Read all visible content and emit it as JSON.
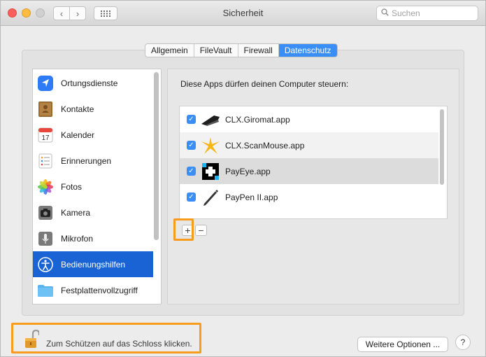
{
  "window": {
    "title": "Sicherheit"
  },
  "search": {
    "placeholder": "Suchen"
  },
  "tabs": [
    {
      "label": "Allgemein",
      "active": false
    },
    {
      "label": "FileVault",
      "active": false
    },
    {
      "label": "Firewall",
      "active": false
    },
    {
      "label": "Datenschutz",
      "active": true
    }
  ],
  "sidebar": {
    "items": [
      {
        "label": "Ortungsdienste",
        "icon": "location-arrow-icon",
        "selected": false
      },
      {
        "label": "Kontakte",
        "icon": "contacts-book-icon",
        "selected": false
      },
      {
        "label": "Kalender",
        "icon": "calendar-icon",
        "selected": false
      },
      {
        "label": "Erinnerungen",
        "icon": "reminders-icon",
        "selected": false
      },
      {
        "label": "Fotos",
        "icon": "photos-flower-icon",
        "selected": false
      },
      {
        "label": "Kamera",
        "icon": "camera-icon",
        "selected": false
      },
      {
        "label": "Mikrofon",
        "icon": "microphone-icon",
        "selected": false
      },
      {
        "label": "Bedienungshilfen",
        "icon": "accessibility-icon",
        "selected": true
      },
      {
        "label": "Festplattenvollzugriff",
        "icon": "folder-icon",
        "selected": false
      }
    ]
  },
  "main": {
    "heading": "Diese Apps dürfen deinen Computer steuern:",
    "apps": [
      {
        "name": "CLX.Giromat.app",
        "checked": true,
        "icon": "giromat-device-icon"
      },
      {
        "name": "CLX.ScanMouse.app",
        "checked": true,
        "icon": "scanmouse-star-icon"
      },
      {
        "name": "PayEye.app",
        "checked": true,
        "icon": "payeye-icon"
      },
      {
        "name": "PayPen II.app",
        "checked": true,
        "icon": "paypen-icon"
      }
    ],
    "add_label": "+",
    "remove_label": "−"
  },
  "footer": {
    "lock_text": "Zum Schützen auf das Schloss klicken.",
    "more_options_label": "Weitere Optionen ...",
    "help_label": "?"
  },
  "colors": {
    "accent": "#3a8ef7",
    "selection": "#1a63d5",
    "highlight": "#f79c1c"
  }
}
